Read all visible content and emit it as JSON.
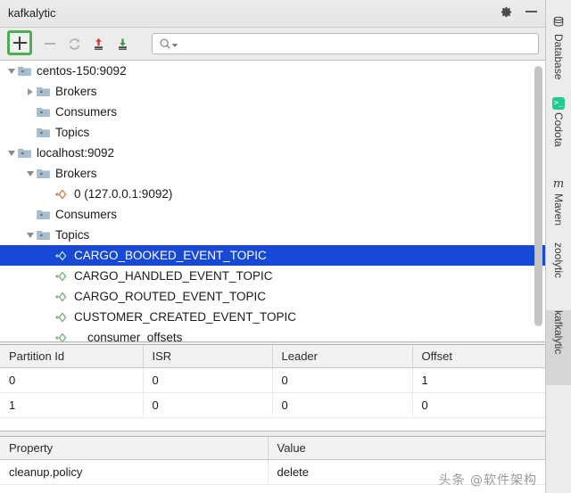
{
  "window": {
    "title": "kafkalytic",
    "gear_icon": "gear-icon",
    "minimize_icon": "minimize-icon"
  },
  "toolbar": {
    "add_label": "+",
    "add_icon": "plus-icon",
    "remove_icon": "minus-icon",
    "refresh_icon": "refresh-icon",
    "publish_icon": "upload-arrow-icon",
    "consume_icon": "download-arrow-icon",
    "search_placeholder": "",
    "search_value": "",
    "search_icon": "search-icon"
  },
  "tree": {
    "rows": [
      {
        "label": "centos-150:9092",
        "indent": 0,
        "twisty": "down",
        "icon": "folder"
      },
      {
        "label": "Brokers",
        "indent": 1,
        "twisty": "right",
        "icon": "folder"
      },
      {
        "label": "Consumers",
        "indent": 1,
        "twisty": "none",
        "icon": "folder"
      },
      {
        "label": "Topics",
        "indent": 1,
        "twisty": "none",
        "icon": "folder"
      },
      {
        "label": "localhost:9092",
        "indent": 0,
        "twisty": "down",
        "icon": "folder"
      },
      {
        "label": "Brokers",
        "indent": 1,
        "twisty": "down",
        "icon": "folder"
      },
      {
        "label": "0 (127.0.0.1:9092)",
        "indent": 2,
        "twisty": "none",
        "icon": "broker"
      },
      {
        "label": "Consumers",
        "indent": 1,
        "twisty": "none",
        "icon": "folder"
      },
      {
        "label": "Topics",
        "indent": 1,
        "twisty": "down",
        "icon": "folder"
      },
      {
        "label": "CARGO_BOOKED_EVENT_TOPIC",
        "indent": 2,
        "twisty": "none",
        "icon": "topic",
        "selected": true
      },
      {
        "label": "CARGO_HANDLED_EVENT_TOPIC",
        "indent": 2,
        "twisty": "none",
        "icon": "topic"
      },
      {
        "label": "CARGO_ROUTED_EVENT_TOPIC",
        "indent": 2,
        "twisty": "none",
        "icon": "topic"
      },
      {
        "label": "CUSTOMER_CREATED_EVENT_TOPIC",
        "indent": 2,
        "twisty": "none",
        "icon": "topic"
      },
      {
        "label": "__consumer_offsets",
        "indent": 2,
        "twisty": "none",
        "icon": "topic"
      }
    ],
    "selected_label": "CARGO_BOOKED_EVENT_TOPIC",
    "selection_color": "#1849d6"
  },
  "partitions": {
    "columns": [
      "Partition Id",
      "ISR",
      "Leader",
      "Offset"
    ],
    "rows": [
      [
        "0",
        "0",
        "0",
        "1"
      ],
      [
        "1",
        "0",
        "0",
        "0"
      ]
    ]
  },
  "properties": {
    "columns": [
      "Property",
      "Value"
    ],
    "rows": [
      [
        "cleanup.policy",
        "delete"
      ]
    ]
  },
  "watermark": "头条 @软件架构",
  "toolstrip": {
    "tabs": [
      {
        "label": "Database",
        "icon": "database-icon",
        "active": false
      },
      {
        "label": "Codota",
        "icon": "codota-icon",
        "active": false
      },
      {
        "label": "Maven",
        "icon": "maven-icon",
        "active": false
      },
      {
        "label": "zoolytic",
        "icon": "none",
        "active": false
      },
      {
        "label": "kafkalytic",
        "icon": "none",
        "active": true
      }
    ]
  }
}
